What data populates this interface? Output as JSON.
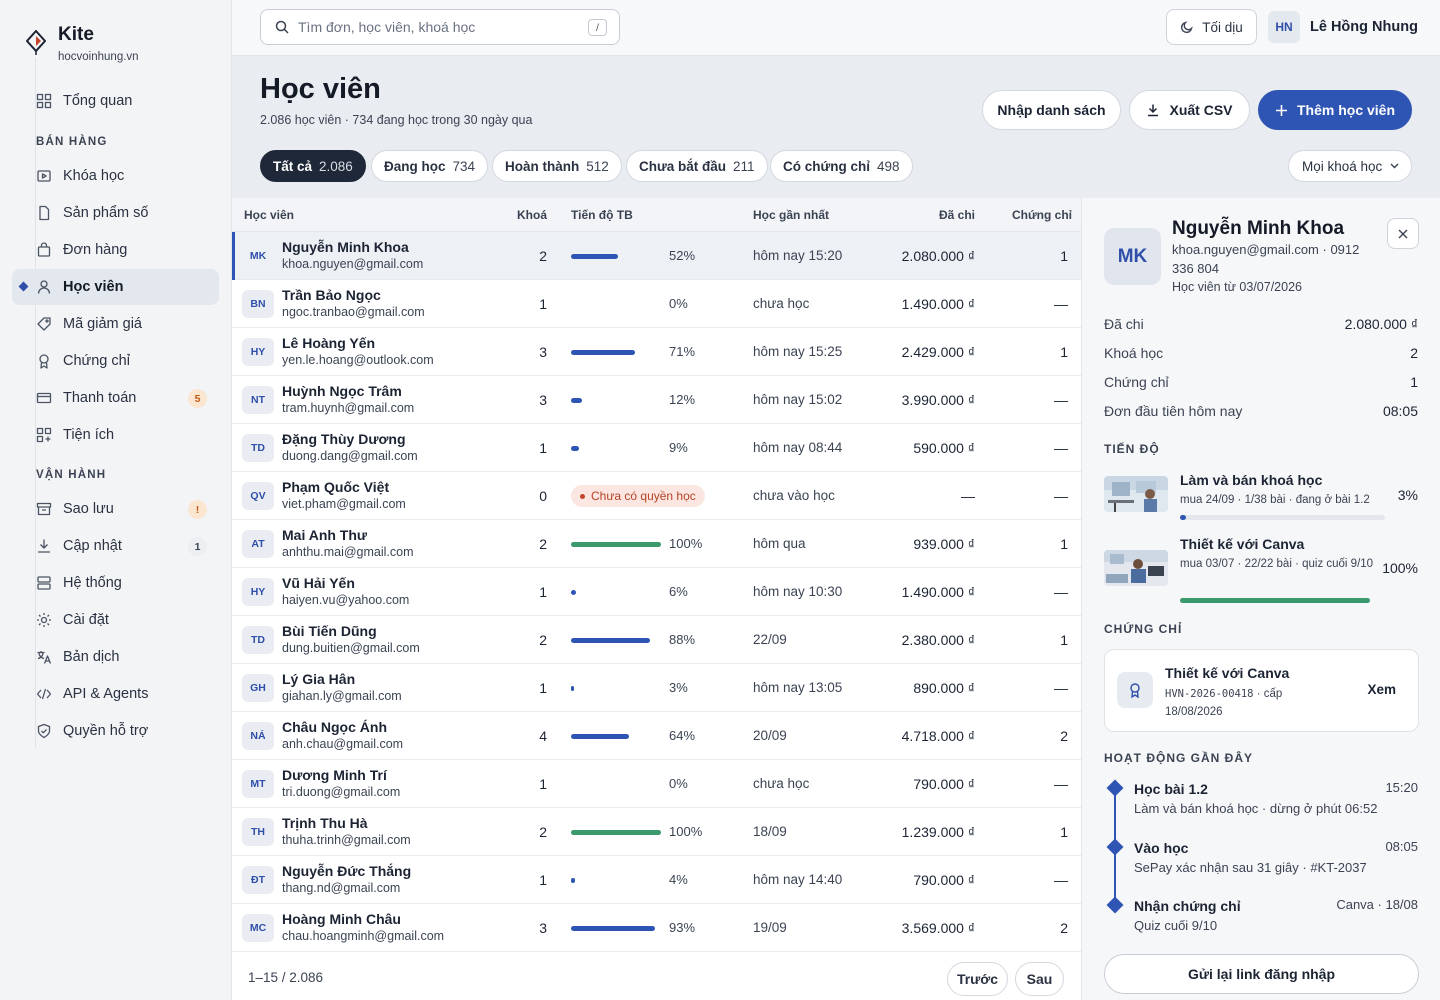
{
  "brand": {
    "name": "Kite",
    "domain": "hocvoinhung.vn"
  },
  "sidebar": {
    "overview": "Tổng quan",
    "sales_section": "BÁN HÀNG",
    "sales_items": [
      {
        "label": "Khóa học",
        "icon": "play-square-icon"
      },
      {
        "label": "Sản phẩm số",
        "icon": "file-icon"
      },
      {
        "label": "Đơn hàng",
        "icon": "bag-icon"
      },
      {
        "label": "Học viên",
        "icon": "user-icon",
        "active": true
      },
      {
        "label": "Mã giảm giá",
        "icon": "tag-icon"
      },
      {
        "label": "Chứng chỉ",
        "icon": "award-icon"
      },
      {
        "label": "Thanh toán",
        "icon": "card-icon",
        "badge": "5"
      },
      {
        "label": "Tiện ích",
        "icon": "apps-icon"
      }
    ],
    "ops_section": "VẬN HÀNH",
    "ops_items": [
      {
        "label": "Sao lưu",
        "icon": "archive-icon",
        "badge": "!"
      },
      {
        "label": "Cập nhật",
        "icon": "download-icon",
        "badge": "1"
      },
      {
        "label": "Hệ thống",
        "icon": "server-icon"
      },
      {
        "label": "Cài đặt",
        "icon": "settings-icon"
      },
      {
        "label": "Bản dịch",
        "icon": "translate-icon"
      },
      {
        "label": "API & Agents",
        "icon": "code-icon"
      },
      {
        "label": "Quyền hỗ trợ",
        "icon": "shield-icon"
      }
    ]
  },
  "topbar": {
    "search_placeholder": "Tìm đơn, học viên, khoá học",
    "search_shortcut": "/",
    "theme_label": "Tối dịu",
    "user_initials": "HN",
    "user_name": "Lê Hồng Nhung"
  },
  "header": {
    "title": "Học viên",
    "subtitle": "2.086 học viên · 734 đang học trong 30 ngày qua",
    "import_label": "Nhập danh sách",
    "export_label": "Xuất CSV",
    "add_label": "Thêm học viên",
    "filters": [
      {
        "label": "Tất cả",
        "count": "2.086",
        "active": true
      },
      {
        "label": "Đang học",
        "count": "734"
      },
      {
        "label": "Hoàn thành",
        "count": "512"
      },
      {
        "label": "Chưa bắt đầu",
        "count": "211"
      },
      {
        "label": "Có chứng chỉ",
        "count": "498"
      }
    ],
    "course_filter": "Mọi khoá học"
  },
  "table": {
    "columns": {
      "student": "Học viên",
      "courses": "Khoá",
      "progress": "Tiến độ TB",
      "last_study": "Học gần nhất",
      "spent": "Đã chi",
      "certs": "Chứng chỉ"
    },
    "rows": [
      {
        "initials": "MK",
        "name": "Nguyễn Minh Khoa",
        "email": "khoa.nguyen@gmail.com",
        "courses": "2",
        "progress": 52,
        "progress_label": "52%",
        "last": "hôm nay 15:20",
        "spent": "2.080.000 ₫",
        "certs": "1",
        "selected": true
      },
      {
        "initials": "BN",
        "name": "Trần Bảo Ngọc",
        "email": "ngoc.tranbao@gmail.com",
        "courses": "1",
        "progress": 0,
        "progress_label": "0%",
        "last": "chưa học",
        "spent": "1.490.000 ₫",
        "certs": "—"
      },
      {
        "initials": "HY",
        "name": "Lê Hoàng Yến",
        "email": "yen.le.hoang@outlook.com",
        "courses": "3",
        "progress": 71,
        "progress_label": "71%",
        "last": "hôm nay 15:25",
        "spent": "2.429.000 ₫",
        "certs": "1"
      },
      {
        "initials": "NT",
        "name": "Huỳnh Ngọc Trâm",
        "email": "tram.huynh@gmail.com",
        "courses": "3",
        "progress": 12,
        "progress_label": "12%",
        "last": "hôm nay 15:02",
        "spent": "3.990.000 ₫",
        "certs": "—"
      },
      {
        "initials": "TD",
        "name": "Đặng Thùy Dương",
        "email": "duong.dang@gmail.com",
        "courses": "1",
        "progress": 9,
        "progress_label": "9%",
        "last": "hôm nay 08:44",
        "spent": "590.000 ₫",
        "certs": "—"
      },
      {
        "initials": "QV",
        "name": "Phạm Quốc Việt",
        "email": "viet.pham@gmail.com",
        "courses": "0",
        "status_pill": "Chưa có quyền học",
        "last": "chưa vào học",
        "spent": "—",
        "certs": "—"
      },
      {
        "initials": "AT",
        "name": "Mai Anh Thư",
        "email": "anhthu.mai@gmail.com",
        "courses": "2",
        "progress": 100,
        "progress_label": "100%",
        "last": "hôm qua",
        "spent": "939.000 ₫",
        "certs": "1"
      },
      {
        "initials": "HY",
        "name": "Vũ Hải Yến",
        "email": "haiyen.vu@yahoo.com",
        "courses": "1",
        "progress": 6,
        "progress_label": "6%",
        "last": "hôm nay 10:30",
        "spent": "1.490.000 ₫",
        "certs": "—"
      },
      {
        "initials": "TD",
        "name": "Bùi Tiến Dũng",
        "email": "dung.buitien@gmail.com",
        "courses": "2",
        "progress": 88,
        "progress_label": "88%",
        "last": "22/09",
        "spent": "2.380.000 ₫",
        "certs": "1"
      },
      {
        "initials": "GH",
        "name": "Lý Gia Hân",
        "email": "giahan.ly@gmail.com",
        "courses": "1",
        "progress": 3,
        "progress_label": "3%",
        "last": "hôm nay 13:05",
        "spent": "890.000 ₫",
        "certs": "—"
      },
      {
        "initials": "NÁ",
        "name": "Châu Ngọc Ánh",
        "email": "anh.chau@gmail.com",
        "courses": "4",
        "progress": 64,
        "progress_label": "64%",
        "last": "20/09",
        "spent": "4.718.000 ₫",
        "certs": "2"
      },
      {
        "initials": "MT",
        "name": "Dương Minh Trí",
        "email": "tri.duong@gmail.com",
        "courses": "1",
        "progress": 0,
        "progress_label": "0%",
        "last": "chưa học",
        "spent": "790.000 ₫",
        "certs": "—"
      },
      {
        "initials": "TH",
        "name": "Trịnh Thu Hà",
        "email": "thuha.trinh@gmail.com",
        "courses": "2",
        "progress": 100,
        "progress_label": "100%",
        "last": "18/09",
        "spent": "1.239.000 ₫",
        "certs": "1"
      },
      {
        "initials": "ĐT",
        "name": "Nguyễn Đức Thắng",
        "email": "thang.nd@gmail.com",
        "courses": "1",
        "progress": 4,
        "progress_label": "4%",
        "last": "hôm nay 14:40",
        "spent": "790.000 ₫",
        "certs": "—"
      },
      {
        "initials": "MC",
        "name": "Hoàng Minh Châu",
        "email": "chau.hoangminh@gmail.com",
        "courses": "3",
        "progress": 93,
        "progress_label": "93%",
        "last": "19/09",
        "spent": "3.569.000 ₫",
        "certs": "2"
      }
    ],
    "pager": {
      "count": "1–15 / 2.086",
      "prev": "Trước",
      "next": "Sau"
    }
  },
  "detail": {
    "initials": "MK",
    "name": "Nguyễn Minh Khoa",
    "contact": "khoa.nguyen@gmail.com · 0912 336 804",
    "since": "Học viên từ 03/07/2026",
    "stats": [
      {
        "label": "Đã chi",
        "value": "2.080.000 ₫"
      },
      {
        "label": "Khoá học",
        "value": "2"
      },
      {
        "label": "Chứng chỉ",
        "value": "1"
      },
      {
        "label": "Đơn đầu tiên hôm nay",
        "value": "08:05"
      }
    ],
    "progress_section": "TIẾN ĐỘ",
    "courses": [
      {
        "title": "Làm và bán khoá học",
        "meta": "mua 24/09 · 1/38 bài · đang ở bài 1.2",
        "pct_label": "3%",
        "progress": 3
      },
      {
        "title": "Thiết kế với Canva",
        "meta": "mua 03/07 · 22/22 bài · quiz cuối 9/10",
        "pct_label": "100%",
        "progress": 100
      }
    ],
    "cert_section": "CHỨNG CHỈ",
    "cert": {
      "title": "Thiết kế với Canva",
      "code": "HVN-2026-00418",
      "meta_suffix": " · cấp 18/08/2026",
      "view": "Xem"
    },
    "activity_section": "HOẠT ĐỘNG GẦN ĐÂY",
    "activity": [
      {
        "title": "Học bài 1.2",
        "desc": "Làm và bán khoá học · dừng ở phút 06:52",
        "time": "15:20"
      },
      {
        "title": "Vào học",
        "desc": "SePay xác nhận sau 31 giây · #KT-2037",
        "time": "08:05"
      },
      {
        "title": "Nhận chứng chỉ",
        "desc": "Quiz cuối 9/10",
        "time": "Canva · 18/08"
      }
    ],
    "resend_label": "Gửi lại link đăng nhập"
  },
  "colors": {
    "accent": "#2f55b4",
    "success": "#3a9a6e",
    "warn": "#c25d16",
    "dark": "#1e2838"
  }
}
